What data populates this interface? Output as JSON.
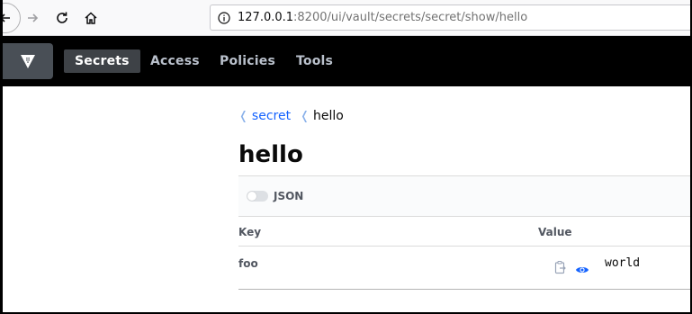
{
  "browser": {
    "url_host": "127.0.0.1",
    "url_rest": ":8200/ui/vault/secrets/secret/show/hello"
  },
  "vault_nav": {
    "items": [
      {
        "label": "Secrets",
        "active": true
      },
      {
        "label": "Access",
        "active": false
      },
      {
        "label": "Policies",
        "active": false
      },
      {
        "label": "Tools",
        "active": false
      }
    ]
  },
  "breadcrumb": {
    "parent": "secret",
    "current": "hello",
    "separator": "❬"
  },
  "page": {
    "title": "hello"
  },
  "json_toggle": {
    "label": "JSON",
    "enabled": false
  },
  "table": {
    "headers": {
      "key": "Key",
      "value": "Value"
    },
    "rows": [
      {
        "key": "foo",
        "value": "world"
      }
    ]
  },
  "colors": {
    "nav_bg": "#000000",
    "accent_link": "#1563ff",
    "eye_icon": "#1563ff"
  },
  "icons": [
    "back-arrow-icon",
    "forward-arrow-icon",
    "reload-icon",
    "home-icon",
    "info-icon",
    "vault-logo-icon",
    "copy-icon",
    "eye-icon"
  ]
}
